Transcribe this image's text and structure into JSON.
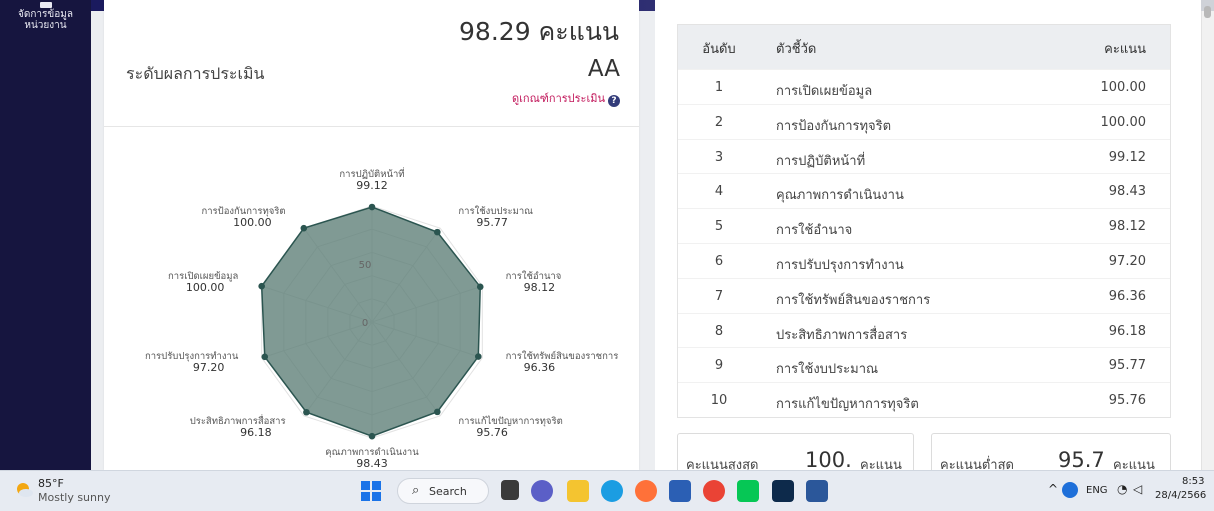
{
  "sidebar": {
    "items": [
      {
        "label_line1": "จัดการข้อมูล",
        "label_line2": "หน่วยงาน",
        "icon": "folder-icon"
      }
    ]
  },
  "summary": {
    "score_text": "98.29 คะแนน",
    "level_label": "ระดับผลการประเมิน",
    "level_value": "AA",
    "criteria_link": "ดูเกณฑ์การประเมิน",
    "help_glyph": "?"
  },
  "chart_data": {
    "type": "radar",
    "rlim": [
      0,
      100
    ],
    "ticks": [
      {
        "value": 0,
        "label": "0"
      },
      {
        "value": 50,
        "label": "50"
      }
    ],
    "axes": [
      {
        "name": "การปฏิบัติหน้าที่",
        "value": 99.12,
        "value_label": "99.12"
      },
      {
        "name": "การใช้งบประมาณ",
        "value": 95.77,
        "value_label": "95.77"
      },
      {
        "name": "การใช้อำนาจ",
        "value": 98.12,
        "value_label": "98.12"
      },
      {
        "name": "การใช้ทรัพย์สินของราชการ",
        "value": 96.36,
        "value_label": "96.36"
      },
      {
        "name": "การแก้ไขปัญหาการทุจริต",
        "value": 95.76,
        "value_label": "95.76"
      },
      {
        "name": "คุณภาพการดำเนินงาน",
        "value": 98.43,
        "value_label": "98.43"
      },
      {
        "name": "ประสิทธิภาพการสื่อสาร",
        "value": 96.18,
        "value_label": "96.18"
      },
      {
        "name": "การปรับปรุงการทำงาน",
        "value": 97.2,
        "value_label": "97.20"
      },
      {
        "name": "การเปิดเผยข้อมูล",
        "value": 100.0,
        "value_label": "100.00"
      },
      {
        "name": "การป้องกันการทุจริต",
        "value": 100.0,
        "value_label": "100.00"
      }
    ],
    "fill_color": "#5c7d76",
    "point_color": "#2b5550",
    "grid": true,
    "legend": "none"
  },
  "ranking": {
    "headers": {
      "rank": "อันดับ",
      "indicator": "ตัวชี้วัด",
      "score": "คะแนน"
    },
    "rows": [
      {
        "rank": "1",
        "name": "การเปิดเผยข้อมูล",
        "score": "100.00"
      },
      {
        "rank": "2",
        "name": "การป้องกันการทุจริต",
        "score": "100.00"
      },
      {
        "rank": "3",
        "name": "การปฏิบัติหน้าที่",
        "score": "99.12"
      },
      {
        "rank": "4",
        "name": "คุณภาพการดำเนินงาน",
        "score": "98.43"
      },
      {
        "rank": "5",
        "name": "การใช้อำนาจ",
        "score": "98.12"
      },
      {
        "rank": "6",
        "name": "การปรับปรุงการทำงาน",
        "score": "97.20"
      },
      {
        "rank": "7",
        "name": "การใช้ทรัพย์สินของราชการ",
        "score": "96.36"
      },
      {
        "rank": "8",
        "name": "ประสิทธิภาพการสื่อสาร",
        "score": "96.18"
      },
      {
        "rank": "9",
        "name": "การใช้งบประมาณ",
        "score": "95.77"
      },
      {
        "rank": "10",
        "name": "การแก้ไขปัญหาการทุจริต",
        "score": "95.76"
      }
    ]
  },
  "extremes": {
    "max_label": "คะแนนสูงสุด",
    "max_value": "100.",
    "max_unit": "คะแนน",
    "min_label": "คะแนนต่ำสุด",
    "min_value": "95.7",
    "min_unit": "คะแนน"
  },
  "taskbar": {
    "weather_temp": "85°F",
    "weather_text": "Mostly sunny",
    "search_label": "Search",
    "search_glyph": "⌕",
    "language": "ENG",
    "time": "8:53",
    "date": "28/4/2566",
    "icons": [
      "windows-start-icon",
      "search-icon",
      "file-explorer-icon",
      "teams-chat-icon",
      "folder-icon",
      "edge-icon",
      "firefox-icon",
      "store-icon",
      "chrome-icon",
      "line-icon",
      "photoshop-icon",
      "word-icon"
    ],
    "tray_glyphs": {
      "chevron": "^",
      "wifi": "◔",
      "speaker": "◁"
    }
  },
  "colors": {
    "sidebar": "#16153f",
    "accent_link": "#c2185b",
    "radar_fill": "#5c7d76"
  }
}
